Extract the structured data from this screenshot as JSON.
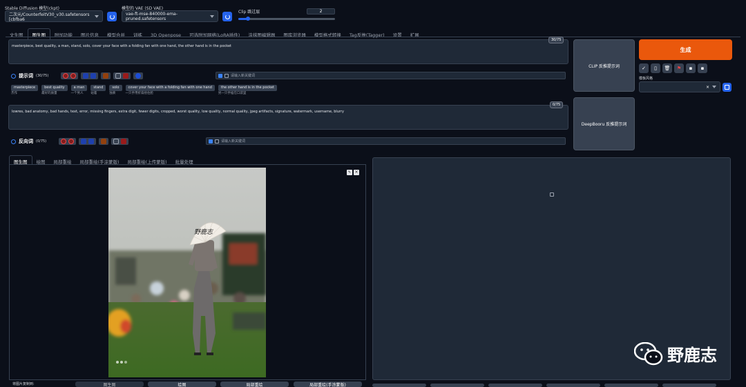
{
  "top": {
    "ckpt_label": "Stable Diffusion 模型(ckpt)",
    "ckpt_value": "二次元/CounterfeitV30_v30.safetensors [cbfba6",
    "vae_label": "模型的 VAE (SD VAE)",
    "vae_value": "vae-ft-mse-840000-ema-pruned.safetensors",
    "clip_label": "Clip 跳过层",
    "clip_value": "2",
    "clip_fraction": 0.1
  },
  "tabs": [
    "文生图",
    "图生图",
    "附加功能",
    "图片信息",
    "模型合并",
    "训练",
    "3D Openpose",
    "可选附加网络(LoRA插件)",
    "涂抹图编辑器",
    "图库浏览器",
    "模型格式转换",
    "Tag反推(Tagger)",
    "设置",
    "扩展"
  ],
  "active_tab": 1,
  "prompt": {
    "text": "masterpiece, best quality, a man, stand, solo, cover your face with a folding fan with one hand, the other hand is in the pocket",
    "counter": "30/75",
    "section_label": "提示词",
    "section_count": "(30/75)",
    "input_placeholder": "请输入新关键词",
    "tags": [
      {
        "en": "masterpiece",
        "zh": "杰作"
      },
      {
        "en": "best quality",
        "zh": "最好的质量"
      },
      {
        "en": "a man",
        "zh": "一个男人"
      },
      {
        "en": "stand",
        "zh": "站着"
      },
      {
        "en": "solo",
        "zh": "独奏"
      },
      {
        "en": "cover your face with a folding fan with one hand",
        "zh": "一只手用折扇捂住脸"
      },
      {
        "en": "the other hand is in the pocket",
        "zh": "另一只手插在口袋里"
      }
    ]
  },
  "negative": {
    "text": "lowres, bad anatomy, bad hands, text, error, missing fingers, extra digit, fewer digits, cropped, worst quality, low quality, normal quality, jpeg artifacts, signature, watermark, username, blurry",
    "counter": "0/75",
    "section_label": "反向词",
    "section_count": "(0/75)",
    "input_placeholder": "请输入新关键词"
  },
  "right": {
    "clip_btn": "CLIP  反推提示词",
    "deepbooru_btn": "DeepBooru 反推提示词",
    "generate": "生成",
    "style_label": "模板风格"
  },
  "subtabs": [
    "图生图",
    "绘图",
    "局部重绘",
    "局部重绘(手涂蒙版)",
    "局部重绘(上传蒙版)",
    "批量处理"
  ],
  "active_subtab": 0,
  "bottom": {
    "copy_label": "将图片复制到:",
    "btn1": "图生图",
    "btn2": "绘图",
    "btn3": "局部重绘",
    "btn4": "局部重绘(手涂蒙版)"
  },
  "image_text": {
    "fan_text": "野鹿志"
  },
  "watermark": {
    "text": "野鹿志"
  },
  "colors": {
    "accent": "#ea580c",
    "blue": "#2563eb",
    "red": "#b91c1c"
  }
}
